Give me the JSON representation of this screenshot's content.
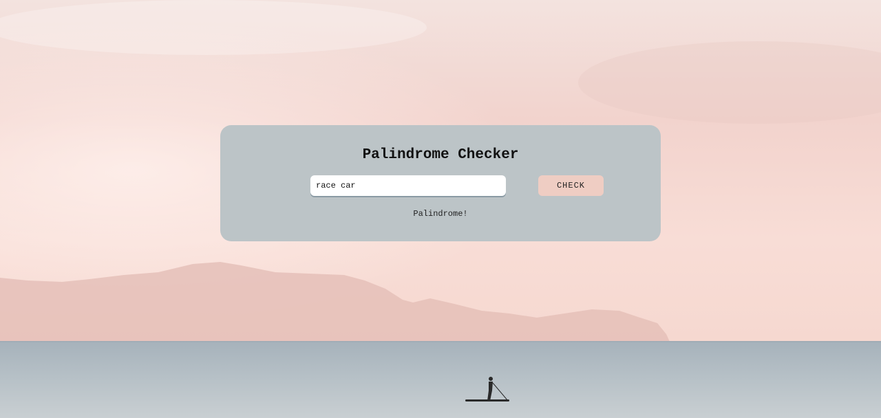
{
  "app": {
    "title": "Palindrome Checker"
  },
  "form": {
    "input_value": "race car",
    "check_label": "CHECK"
  },
  "result": {
    "text": "Palindrome!"
  },
  "colors": {
    "card": "#bcc4c7",
    "button": "#efcdc3",
    "input": "#ffffff"
  }
}
